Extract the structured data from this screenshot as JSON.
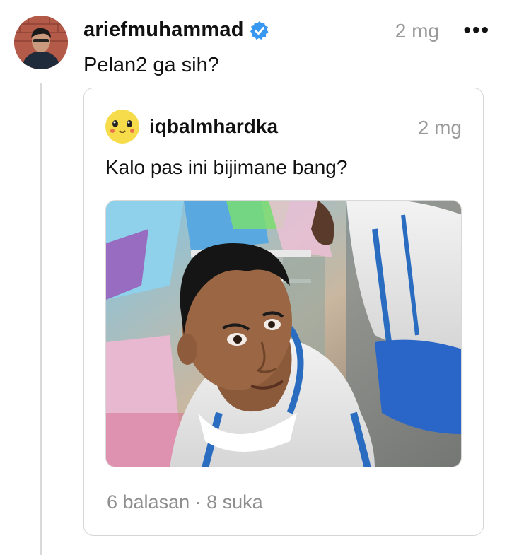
{
  "post": {
    "username": "ariefmuhammad",
    "verified": true,
    "time": "2 mg",
    "more_label": "•••",
    "caption": "Pelan2 ga sih?"
  },
  "quoted": {
    "username": "iqbalmhardka",
    "time": "2 mg",
    "text": "Kalo pas ini bijimane bang?",
    "replies": "6 balasan",
    "separator": "·",
    "likes": "8 suka"
  },
  "colors": {
    "verified_badge": "#3897f0",
    "meta_text": "#9a9a9a",
    "thread_line": "#d9d9d9",
    "card_border": "#d6d6d6"
  },
  "icons": {
    "verified": "verified-badge-icon",
    "more": "more-options-icon"
  }
}
